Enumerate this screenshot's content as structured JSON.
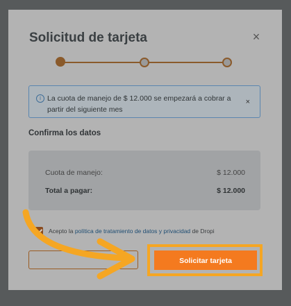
{
  "modal": {
    "title": "Solicitud de tarjeta",
    "close_icon": "close-icon",
    "stepper": {
      "steps": 3,
      "current": 1
    },
    "alert": {
      "icon": "info-icon",
      "text": "La cuota de manejo de $ 12.000 se empezará a cobrar a partir del siguiente mes",
      "close": "×"
    },
    "section_title": "Confirma los datos",
    "summary": [
      {
        "label": "Cuota de manejo:",
        "value": "$ 12.000"
      },
      {
        "label": "Total a pagar:",
        "value": "$ 12.000"
      }
    ],
    "terms": {
      "checked": true,
      "prefix": "Acepto la",
      "link": "política de tratamiento de datos y privacidad",
      "suffix": "de Dropi"
    },
    "submit_label": "Solicitar tarjeta"
  },
  "colors": {
    "accent": "#f47a1f",
    "highlight": "#f5a623",
    "info": "#5a86b0"
  }
}
